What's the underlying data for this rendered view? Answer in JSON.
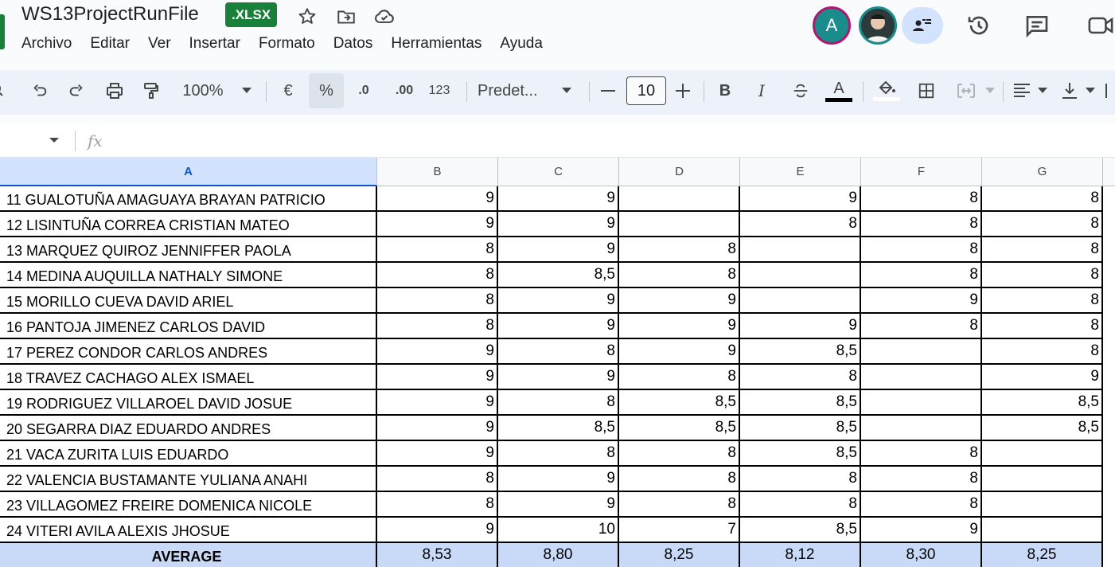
{
  "doc": {
    "title": "WS13ProjectRunFile",
    "badge": ".XLSX"
  },
  "menu": [
    "Archivo",
    "Editar",
    "Ver",
    "Insertar",
    "Formato",
    "Datos",
    "Herramientas",
    "Ayuda"
  ],
  "avatar_letter": "A",
  "toolbar": {
    "zoom": "100%",
    "currency": "€",
    "percent": "%",
    "dec_less": ".0",
    "dec_more": ".00",
    "number_format": "123",
    "font": "Predet...",
    "font_size": "10",
    "bold": "B",
    "italic": "I",
    "text_color_letter": "A"
  },
  "formula_bar": {
    "fx": "fx"
  },
  "columns": [
    "A",
    "B",
    "C",
    "D",
    "E",
    "F",
    "G"
  ],
  "rows": [
    {
      "name": "11 GUALOTUÑA AMAGUAYA BRAYAN PATRICIO",
      "b": "9",
      "c": "9",
      "d": "",
      "e": "9",
      "f": "8",
      "g": "8"
    },
    {
      "name": "12 LISINTUÑA CORREA CRISTIAN MATEO",
      "b": "9",
      "c": "9",
      "d": "",
      "e": "8",
      "f": "8",
      "g": "8"
    },
    {
      "name": "13 MARQUEZ QUIROZ JENNIFFER PAOLA",
      "b": "8",
      "c": "9",
      "d": "8",
      "e": "",
      "f": "8",
      "g": "8"
    },
    {
      "name": "14 MEDINA AUQUILLA NATHALY SIMONE",
      "b": "8",
      "c": "8,5",
      "d": "8",
      "e": "",
      "f": "8",
      "g": "8"
    },
    {
      "name": "15 MORILLO CUEVA DAVID ARIEL",
      "b": "8",
      "c": "9",
      "d": "9",
      "e": "",
      "f": "9",
      "g": "8"
    },
    {
      "name": "16 PANTOJA JIMENEZ CARLOS DAVID",
      "b": "8",
      "c": "9",
      "d": "9",
      "e": "9",
      "f": "8",
      "g": "8"
    },
    {
      "name": "17 PEREZ CONDOR CARLOS ANDRES",
      "b": "9",
      "c": "8",
      "d": "9",
      "e": "8,5",
      "f": "",
      "g": "8"
    },
    {
      "name": "18 TRAVEZ CACHAGO ALEX ISMAEL",
      "b": "9",
      "c": "9",
      "d": "8",
      "e": "8",
      "f": "",
      "g": "9"
    },
    {
      "name": "19 RODRIGUEZ VILLAROEL DAVID JOSUE",
      "b": "9",
      "c": "8",
      "d": "8,5",
      "e": "8,5",
      "f": "",
      "g": "8,5"
    },
    {
      "name": "20 SEGARRA DIAZ EDUARDO ANDRES",
      "b": "9",
      "c": "8,5",
      "d": "8,5",
      "e": "8,5",
      "f": "",
      "g": "8,5"
    },
    {
      "name": "21 VACA ZURITA LUIS EDUARDO",
      "b": "9",
      "c": "8",
      "d": "8",
      "e": "8,5",
      "f": "8",
      "g": ""
    },
    {
      "name": "22 VALENCIA BUSTAMANTE YULIANA ANAHI",
      "b": "8",
      "c": "9",
      "d": "8",
      "e": "8",
      "f": "8",
      "g": ""
    },
    {
      "name": "23  VILLAGOMEZ FREIRE DOMENICA NICOLE",
      "b": "8",
      "c": "9",
      "d": "8",
      "e": "8",
      "f": "8",
      "g": ""
    },
    {
      "name": "24  VITERI AVILA ALEXIS JHOSUE",
      "b": "9",
      "c": "10",
      "d": "7",
      "e": "8,5",
      "f": "9",
      "g": ""
    }
  ],
  "average": {
    "name": "AVERAGE",
    "b": "8,53",
    "c": "8,80",
    "d": "8,25",
    "e": "8,12",
    "f": "8,30",
    "g": "8,25"
  },
  "colors": {
    "brand_green": "#188038",
    "avg_row": "#c9daf8",
    "selected_col": "#d3e3fd"
  }
}
